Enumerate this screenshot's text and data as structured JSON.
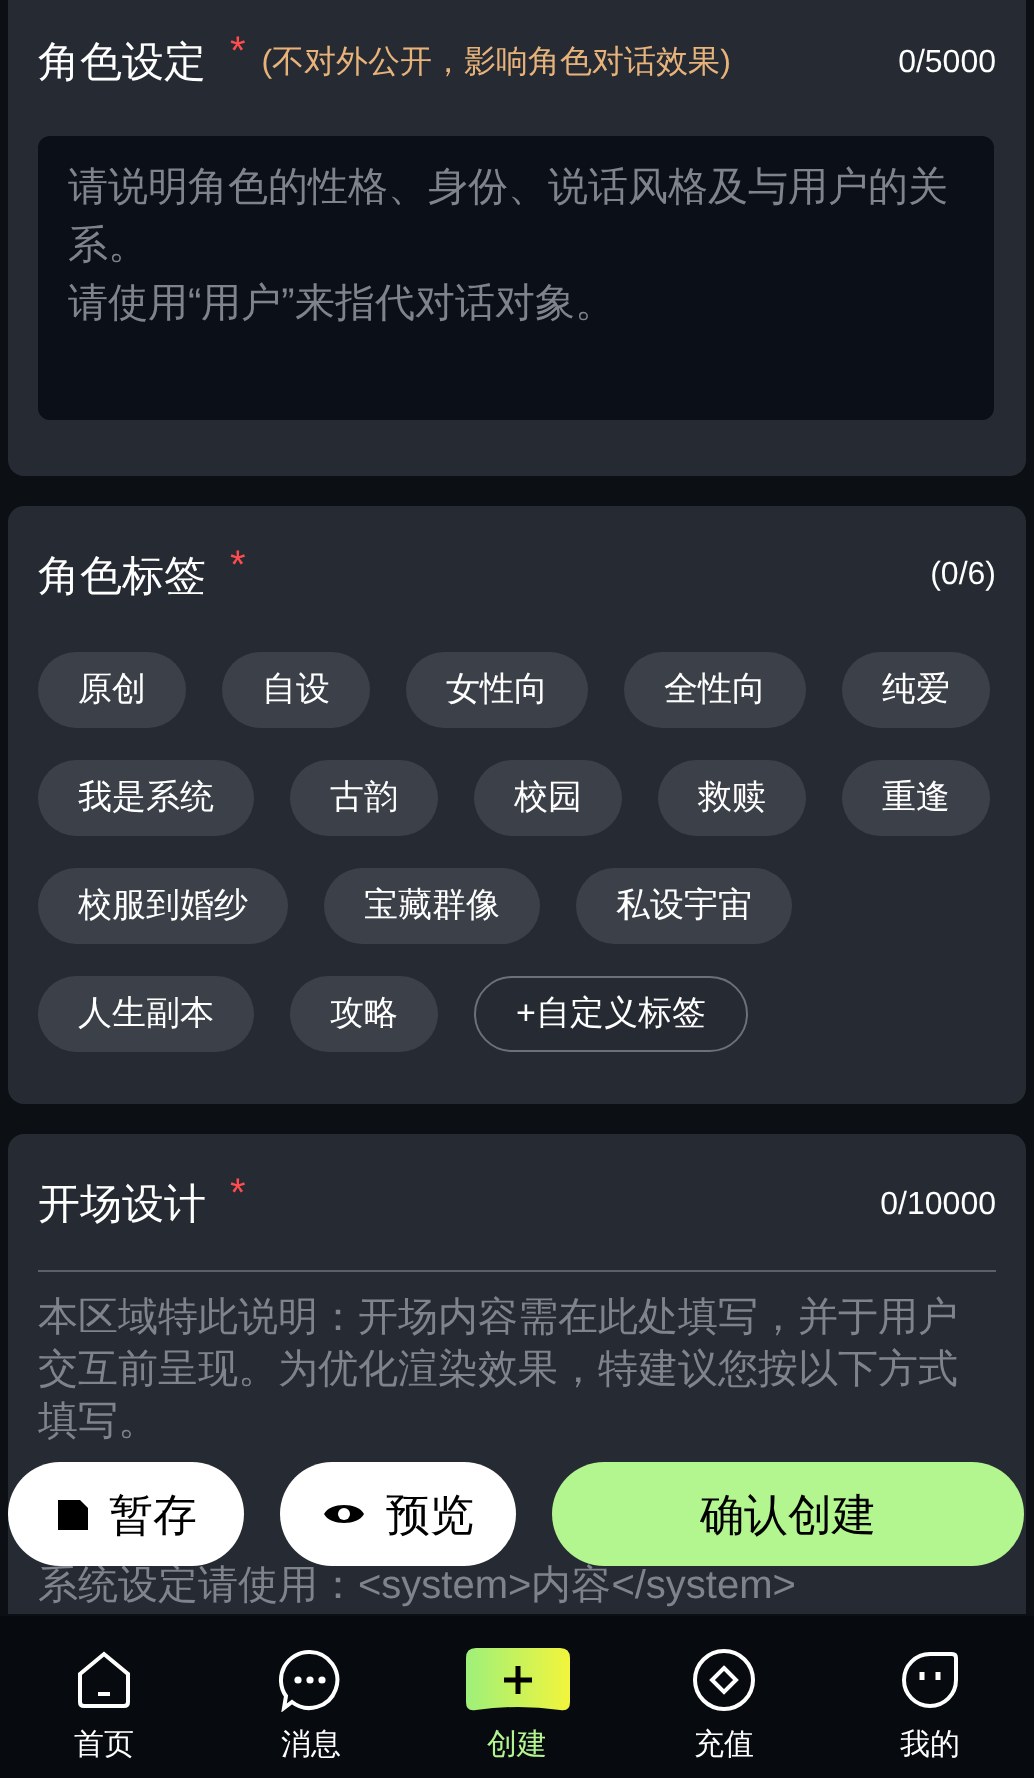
{
  "persona": {
    "title": "角色设定",
    "required_mark": "*",
    "note": "(不对外公开，影响角色对话效果)",
    "counter": "0/5000",
    "placeholder_lines": [
      "请说明角色的性格、身份、说话风格及与用户的关系。",
      "请使用“用户”来指代对话对象。"
    ]
  },
  "tags": {
    "title": "角色标签",
    "required_mark": "*",
    "counter": "(0/6)",
    "items": [
      {
        "label": "原创",
        "kind": "tag",
        "selected": false
      },
      {
        "label": "自设",
        "kind": "tag",
        "selected": false
      },
      {
        "label": "女性向",
        "kind": "tag",
        "selected": false
      },
      {
        "label": "全性向",
        "kind": "tag",
        "selected": false
      },
      {
        "label": "纯爱",
        "kind": "tag",
        "selected": false
      },
      {
        "label": "我是系统",
        "kind": "tag",
        "selected": false
      },
      {
        "label": "古韵",
        "kind": "tag",
        "selected": false
      },
      {
        "label": "校园",
        "kind": "tag",
        "selected": false
      },
      {
        "label": "救赎",
        "kind": "tag",
        "selected": false
      },
      {
        "label": "重逢",
        "kind": "tag",
        "selected": false
      },
      {
        "label": "校服到婚纱",
        "kind": "tag",
        "selected": false
      },
      {
        "label": "宝藏群像",
        "kind": "tag",
        "selected": false
      },
      {
        "label": "私设宇宙",
        "kind": "tag",
        "selected": false
      },
      {
        "label": "人生副本",
        "kind": "tag",
        "selected": false
      },
      {
        "label": "攻略",
        "kind": "tag",
        "selected": false
      },
      {
        "label": "+自定义标签",
        "kind": "custom"
      }
    ]
  },
  "opening": {
    "title": "开场设计",
    "required_mark": "*",
    "counter": "0/10000",
    "placeholder": "本区域特此说明：开场内容需在此处填写，并于用户交互前呈现。为优化渲染效果，特建议您按以下方式填写。",
    "placeholder_last_line": "系统设定请使用：<system>内容</system>"
  },
  "actions": [
    {
      "label": "暂存",
      "kind": "save"
    },
    {
      "label": "预览",
      "kind": "preview"
    },
    {
      "label": "确认创建",
      "kind": "primary"
    }
  ],
  "nav": [
    {
      "label": "首页",
      "selected": false
    },
    {
      "label": "消息",
      "selected": false
    },
    {
      "label": "创建",
      "selected": true
    },
    {
      "label": "充值",
      "selected": false
    },
    {
      "label": "我的",
      "selected": false
    }
  ]
}
